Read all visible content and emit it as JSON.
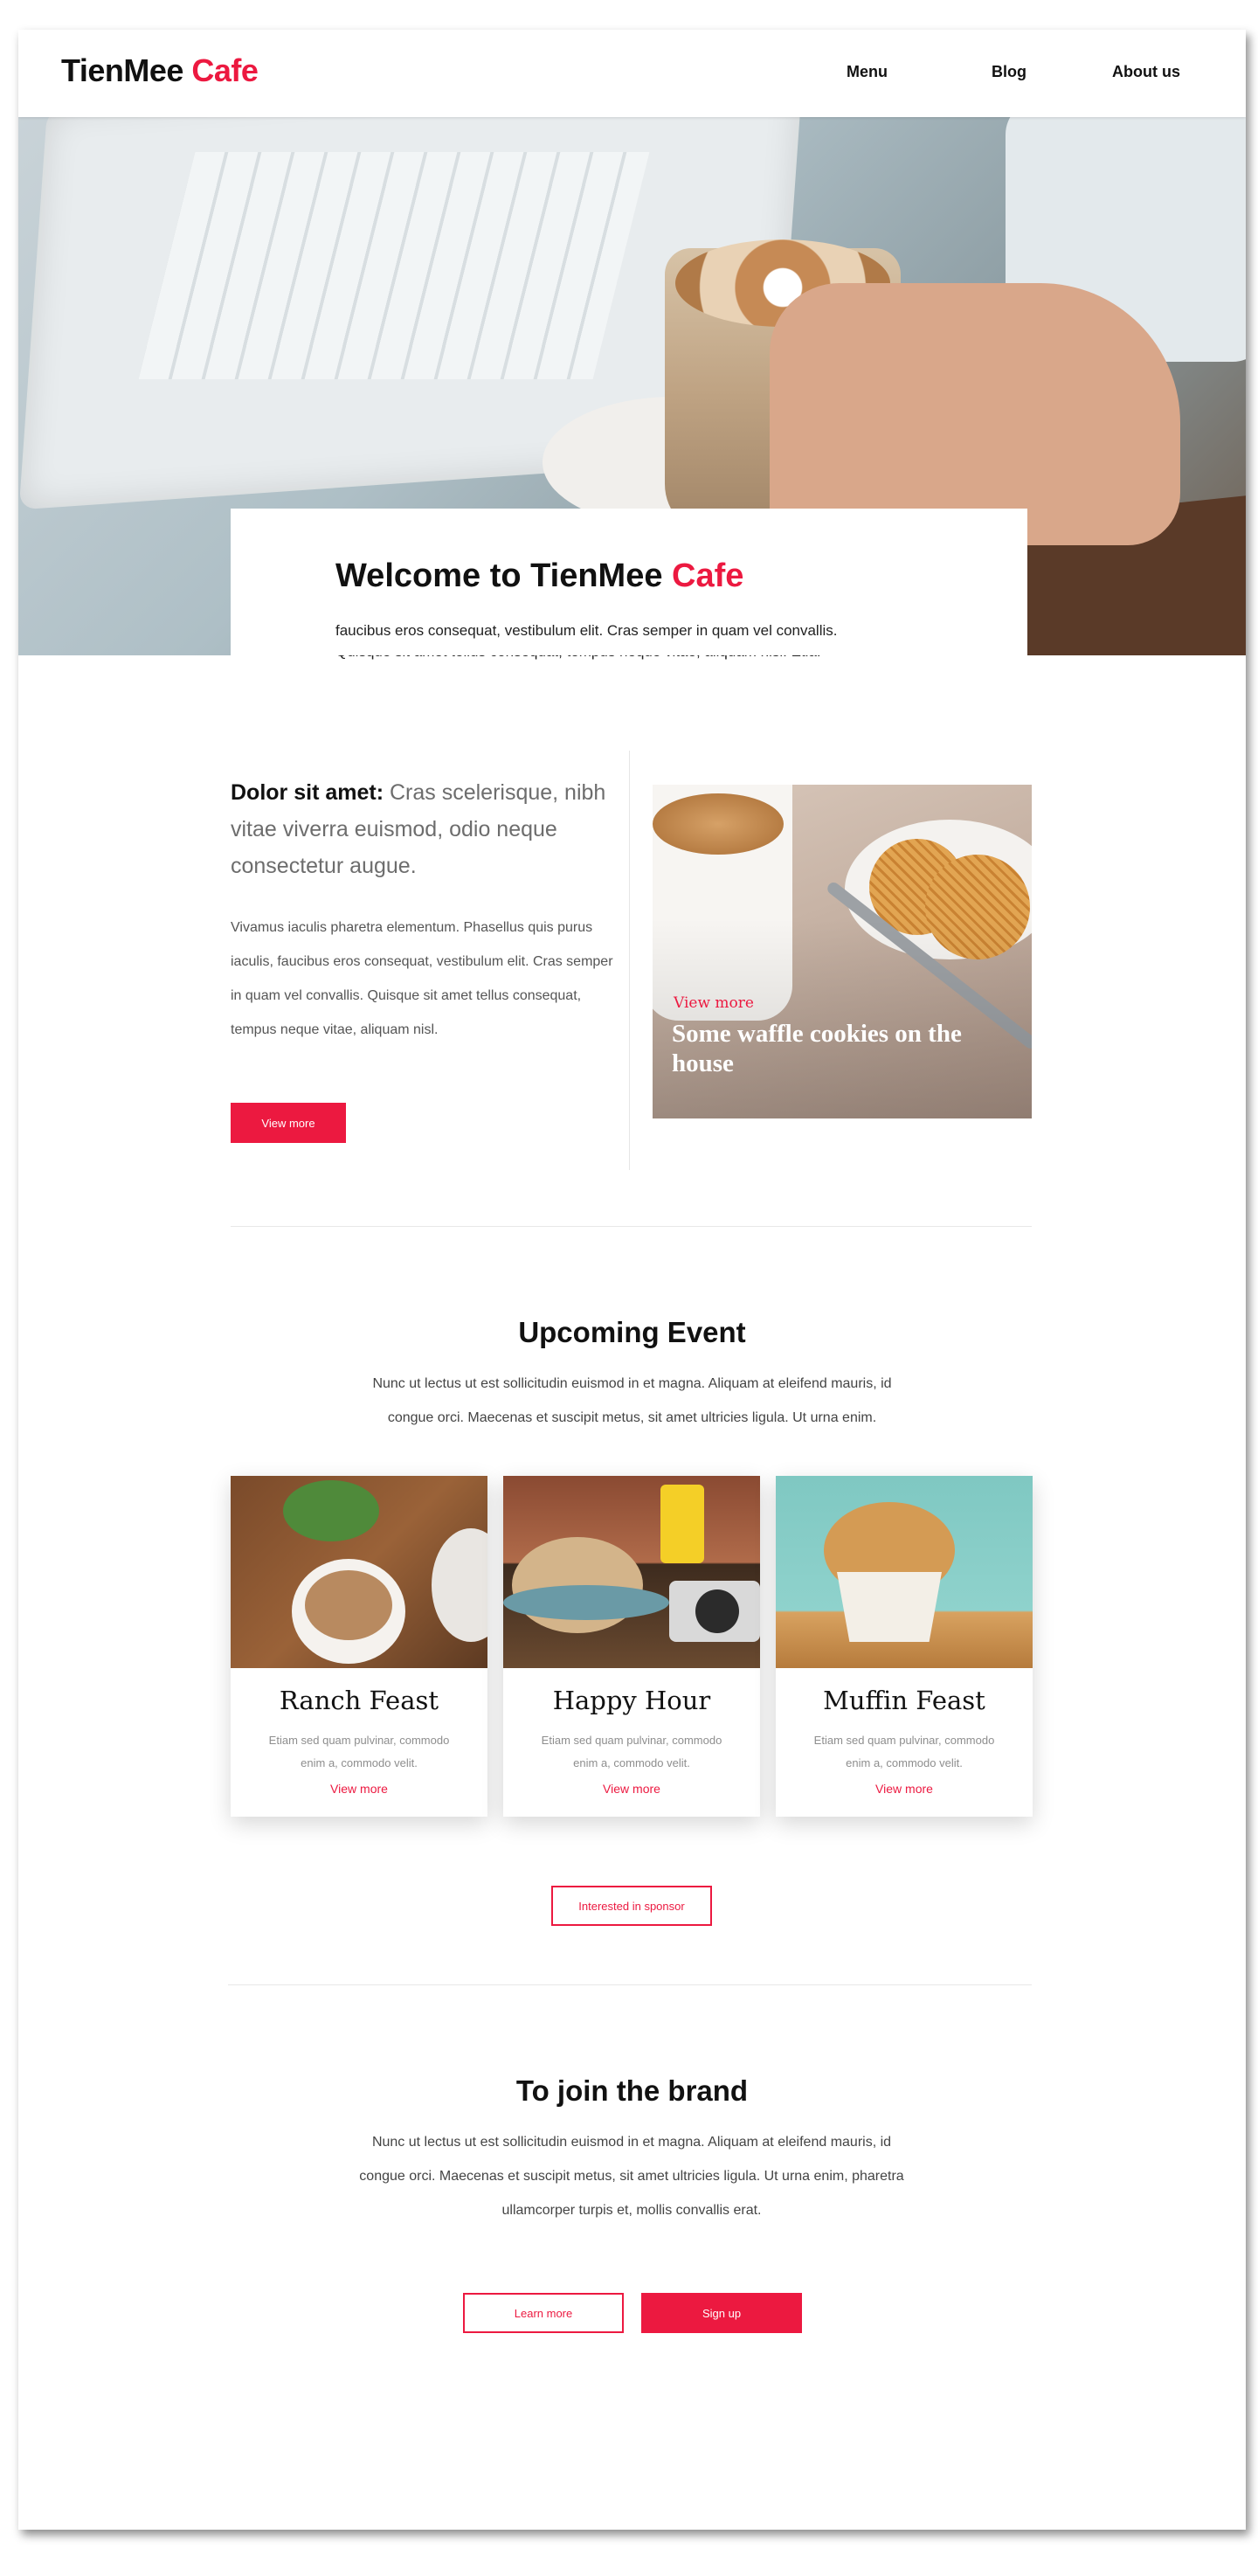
{
  "brand": {
    "name_part1": "TienMee",
    "name_part2": "Cafe"
  },
  "nav": {
    "items": [
      {
        "label": "Menu"
      },
      {
        "label": "Blog"
      },
      {
        "label": "About us"
      }
    ]
  },
  "hero": {
    "title_part1": "Welcome to TienMee",
    "title_part2": "Cafe",
    "line1": "faucibus eros consequat, vestibulum elit. Cras semper in quam vel convallis.",
    "line2": "Quisque sit amet tellus consequat, tempus neque vitae, aliquam nisl. Etia."
  },
  "feature": {
    "lead_bold": "Dolor sit amet:",
    "lead_rest": "Cras scelerisque, nibh vitae viverra euismod, odio neque consectetur augue.",
    "body": "Vivamus iaculis pharetra elementum. Phasellus quis purus iaculis, faucibus eros consequat, vestibulum elit. Cras semper in quam vel convallis. Quisque sit amet tellus consequat, tempus neque vitae, aliquam nisl.",
    "button": "View more",
    "image_link": "View more",
    "image_caption": "Some waffle cookies on the house"
  },
  "events": {
    "title": "Upcoming Event",
    "text": "Nunc ut lectus ut est sollicitudin euismod in et magna. Aliquam at eleifend mauris, id congue orci. Maecenas et suscipit metus, sit amet ultricies ligula. Ut urna enim.",
    "cards": [
      {
        "title": "Ranch Feast",
        "text": "Etiam sed quam pulvinar, commodo enim a, commodo velit.",
        "link": "View more"
      },
      {
        "title": "Happy Hour",
        "text": "Etiam sed quam pulvinar, commodo enim a, commodo velit.",
        "link": "View more"
      },
      {
        "title": "Muffin Feast",
        "text": "Etiam sed quam pulvinar, commodo enim a, commodo velit.",
        "link": "View more"
      }
    ],
    "sponsor_button": "Interested in sponsor"
  },
  "join": {
    "title": "To join the brand",
    "text": "Nunc ut lectus ut est sollicitudin euismod in et magna. Aliquam at eleifend mauris, id congue orci. Maecenas et suscipit metus, sit amet ultricies ligula. Ut urna enim, pharetra ullamcorper turpis et, mollis convallis erat.",
    "learn_more": "Learn more",
    "sign_up": "Sign up"
  },
  "colors": {
    "accent": "#ec1940",
    "text": "#111111",
    "muted": "#6d6d6d"
  }
}
